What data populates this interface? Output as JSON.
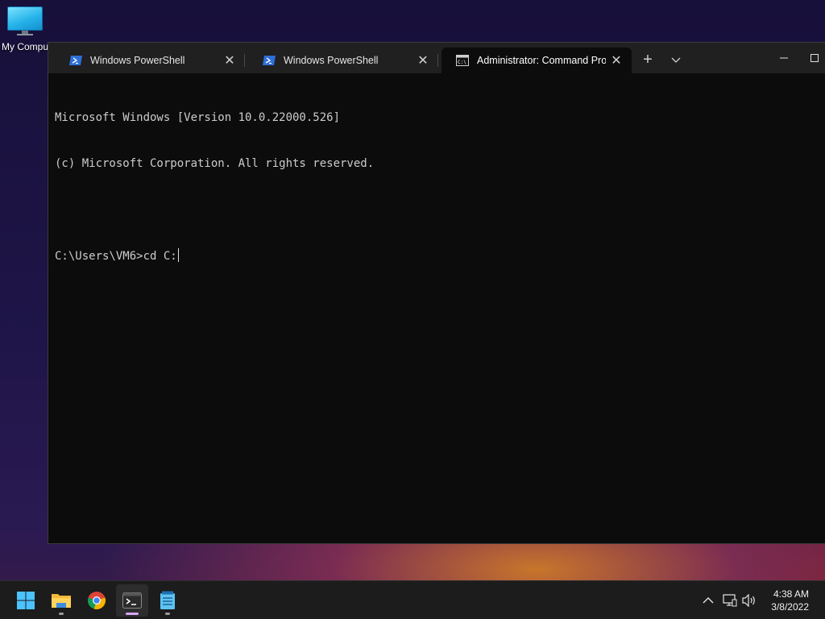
{
  "desktop": {
    "icons": [
      {
        "label": "My Compu",
        "icon": "monitor-icon"
      }
    ]
  },
  "terminal": {
    "tabs": [
      {
        "title": "Windows PowerShell",
        "icon": "powershell-icon",
        "active": false
      },
      {
        "title": "Windows PowerShell",
        "icon": "powershell-icon",
        "active": false
      },
      {
        "title": "Administrator: Command Promp",
        "icon": "cmd-icon",
        "active": true
      }
    ],
    "new_tab_symbol": "+",
    "dropdown_symbol": "⌵",
    "close_symbol": "✕",
    "minimize_symbol": "—",
    "maximize_symbol": "☐",
    "console_lines": [
      "Microsoft Windows [Version 10.0.22000.526]",
      "(c) Microsoft Corporation. All rights reserved.",
      "",
      "C:\\Users\\VM6>cd C:"
    ]
  },
  "taskbar": {
    "apps": [
      {
        "name": "start",
        "icon": "windows-start-icon",
        "running": false
      },
      {
        "name": "file-explorer",
        "icon": "folder-icon",
        "running": true
      },
      {
        "name": "chrome",
        "icon": "chrome-icon",
        "running": false
      },
      {
        "name": "terminal",
        "icon": "terminal-icon",
        "running": true,
        "focused": true
      },
      {
        "name": "notepad",
        "icon": "notepad-icon",
        "running": true
      }
    ],
    "tray": {
      "chevron": "^",
      "icons": [
        "network-icon",
        "volume-icon"
      ]
    },
    "clock": {
      "time": "4:38 AM",
      "date": "3/8/2022"
    }
  },
  "colors": {
    "console_bg": "#0c0c0c",
    "titlebar_bg": "#202020",
    "taskbar_bg": "#1c1c1c",
    "active_indicator": "#d9a6ff",
    "powershell_blue": "#2e6fd8"
  }
}
